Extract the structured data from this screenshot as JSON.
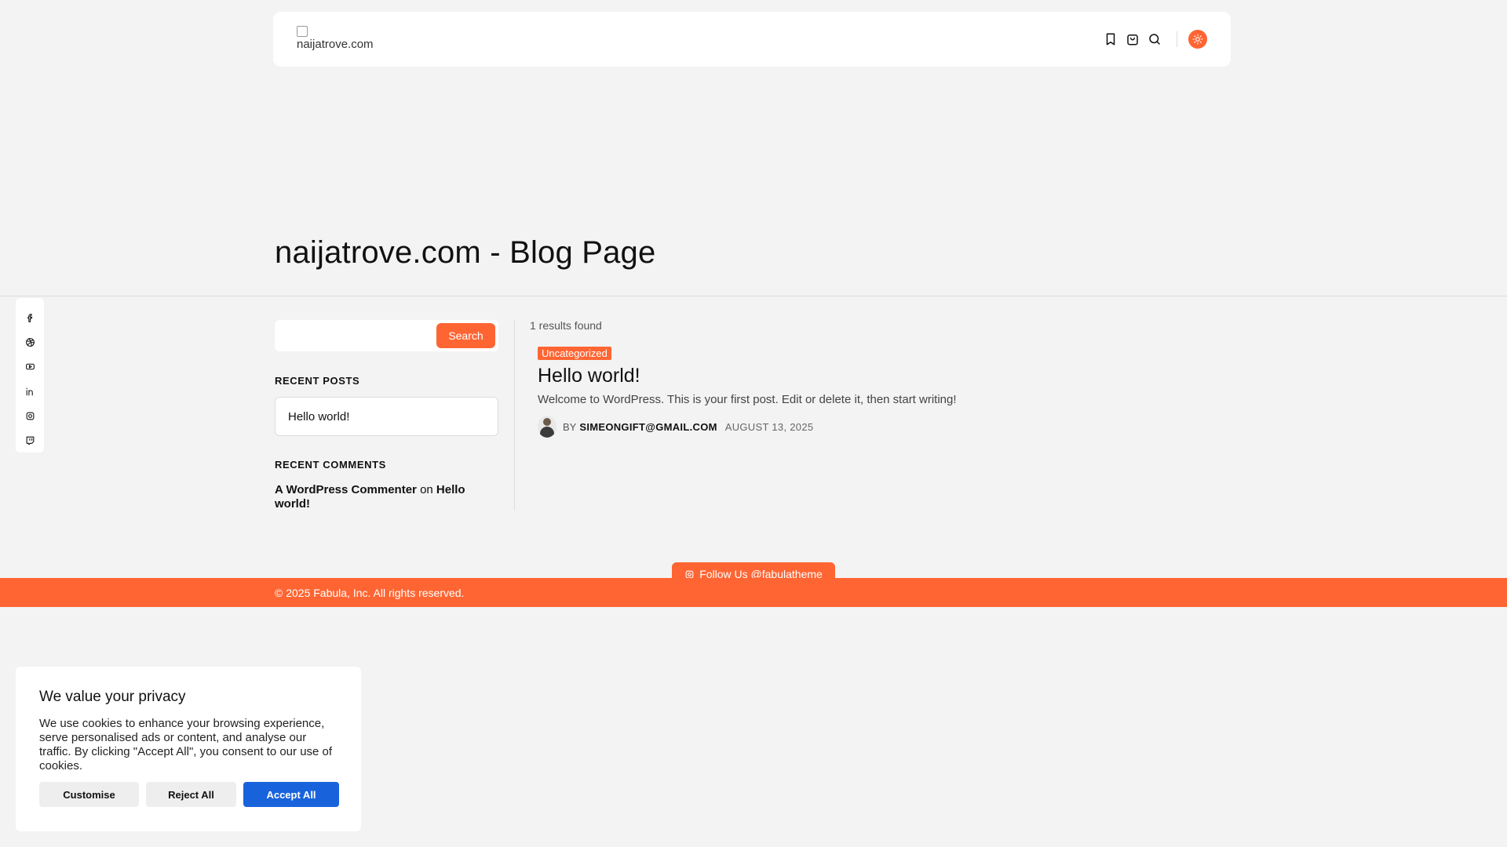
{
  "header": {
    "logo_alt": "naijatrove.com",
    "icons": [
      "bookmark-icon",
      "shopping-bag-icon",
      "search-icon",
      "sun-icon"
    ]
  },
  "page": {
    "title": "naijatrove.com - Blog Page"
  },
  "social": {
    "icons": [
      "facebook-icon",
      "dribbble-icon",
      "youtube-icon",
      "linkedin-icon",
      "instagram-icon",
      "twitch-icon"
    ]
  },
  "sidebar": {
    "search_placeholder": "",
    "search_button": "Search",
    "recent_posts_title": "RECENT POSTS",
    "recent_posts": [
      "Hello world!"
    ],
    "recent_comments_title": "RECENT COMMENTS",
    "comment": {
      "author": "A WordPress Commenter",
      "on": "on",
      "post": "Hello world!"
    }
  },
  "results": {
    "count_text": "1 results found",
    "posts": [
      {
        "category": "Uncategorized",
        "title": "Hello world!",
        "excerpt": "Welcome to WordPress. This is your first post. Edit or delete it, then start writing!",
        "by": "BY",
        "author": "SIMEONGIFT@GMAIL.COM",
        "date": "AUGUST 13, 2025"
      }
    ]
  },
  "footer": {
    "follow_label": "Follow Us @fabulatheme",
    "copyright": "© 2025 Fabula, Inc. All rights reserved."
  },
  "cookie": {
    "title": "We value your privacy",
    "body": "We use cookies to enhance your browsing experience, serve personalised ads or content, and analyse our traffic. By clicking \"Accept All\", you consent to our use of cookies.",
    "customise": "Customise",
    "reject": "Reject All",
    "accept": "Accept All"
  },
  "colors": {
    "accent": "#ff6533",
    "accept_blue": "#1863dc",
    "background": "#f3f3f3"
  }
}
